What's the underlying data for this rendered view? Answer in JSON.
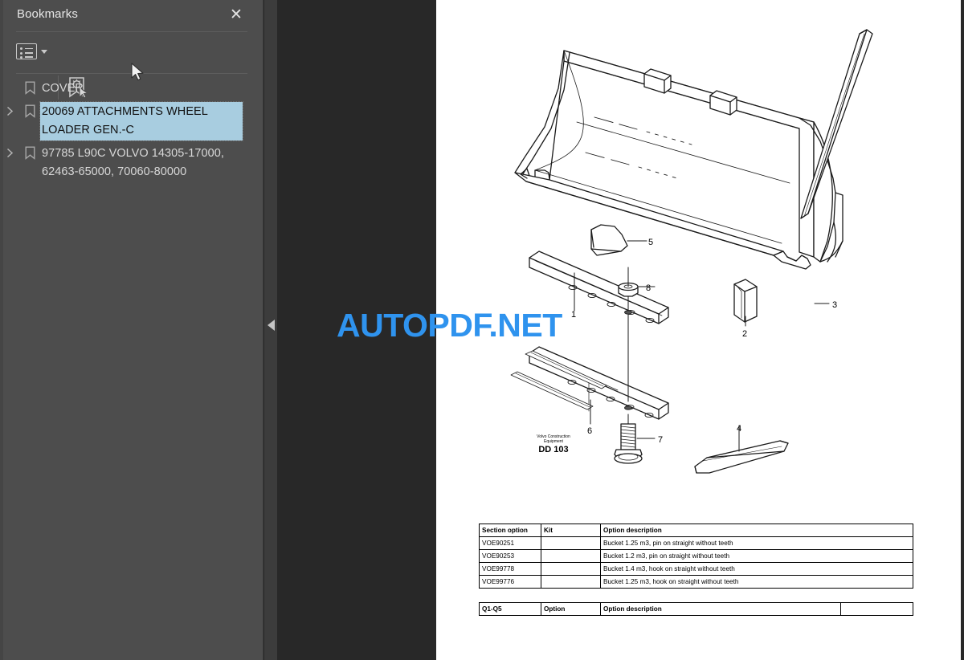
{
  "sidebar": {
    "title": "Bookmarks",
    "close_label": "✕",
    "toolbar": {
      "options_icon": "list-options-icon",
      "options_caret": "chevron-down-icon",
      "new_bookmark_icon": "new-bookmark-icon"
    },
    "bookmarks": [
      {
        "label": "COVER",
        "expandable": false,
        "selected": false
      },
      {
        "label": "20069 ATTACHMENTS WHEEL LOADER GEN.-C",
        "expandable": true,
        "selected": true
      },
      {
        "label": "97785 L90C VOLVO 14305-17000, 62463-65000, 70060-80000",
        "expandable": true,
        "selected": false
      }
    ]
  },
  "divider": {
    "collapse_icon": "collapse-left-arrow-icon"
  },
  "page": {
    "watermark": "AUTOPDF.NET",
    "drawing": {
      "title_block": {
        "line1": "Volvo Construction",
        "line2": "Equipment",
        "line3": "DD 103"
      },
      "callouts": [
        "1",
        "2",
        "3",
        "4",
        "5",
        "6",
        "7",
        "8"
      ]
    },
    "table1": {
      "headers": [
        "Section option",
        "Kit",
        "Option description"
      ],
      "rows": [
        [
          "VOE90251",
          "",
          "Bucket 1.25 m3, pin on straight without teeth"
        ],
        [
          "VOE90253",
          "",
          "Bucket 1.2 m3, pin on straight without teeth"
        ],
        [
          "VOE99778",
          "",
          "Bucket 1.4 m3, hook on straight without teeth"
        ],
        [
          "VOE99776",
          "",
          "Bucket 1.25 m3, hook on straight without teeth"
        ]
      ]
    },
    "table2": {
      "headers": [
        "Q1-Q5",
        "Option",
        "Option description",
        ""
      ]
    }
  },
  "colors": {
    "sidebar_bg": "#4d4d4d",
    "gutter_bg": "#282828",
    "divider_bg": "#3c3c3c",
    "selection": "#a8cde0",
    "watermark": "#2f93ee",
    "page_bg": "#ffffff"
  }
}
